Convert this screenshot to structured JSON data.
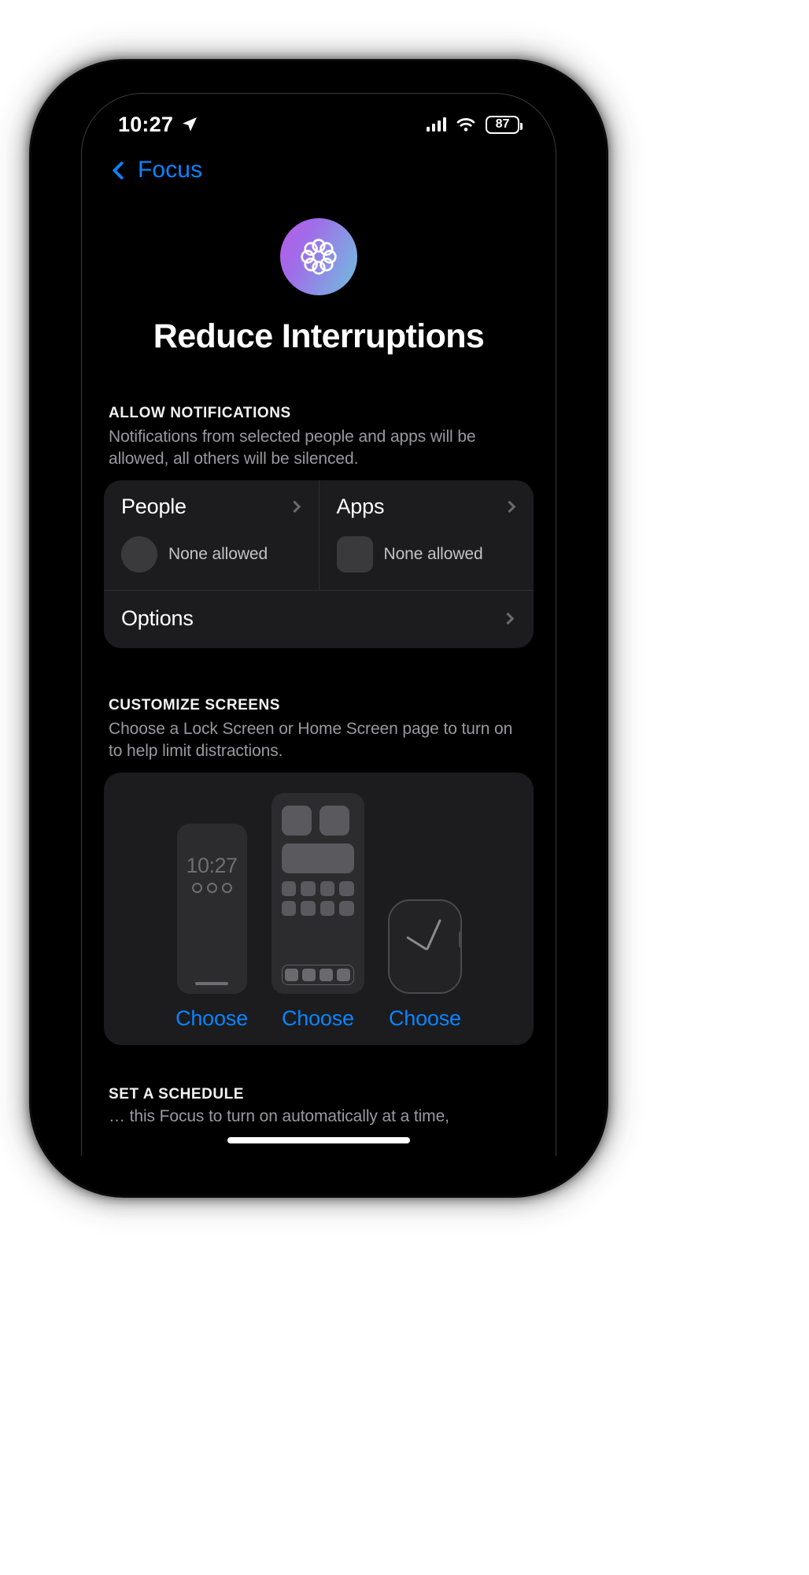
{
  "status_bar": {
    "time": "10:27",
    "location_icon": "location-arrow-icon",
    "cellular_icon": "cellular-bars-icon",
    "wifi_icon": "wifi-icon",
    "battery_percent": "87"
  },
  "nav": {
    "back_label": "Focus",
    "back_icon": "chevron-left-icon",
    "accent": "#0A84FF"
  },
  "hero": {
    "icon_name": "reduce-interruptions-focus-icon",
    "gradient_from": "#B75CE8",
    "gradient_to": "#6FC0DD",
    "title": "Reduce Interruptions"
  },
  "allow_notifications": {
    "header": "ALLOW NOTIFICATIONS",
    "description": "Notifications from selected people and apps will be allowed, all others will be silenced.",
    "people": {
      "title": "People",
      "chevron": "chevron-right-icon",
      "avatar": "person-avatar-placeholder",
      "status": "None allowed"
    },
    "apps": {
      "title": "Apps",
      "chevron": "chevron-right-icon",
      "avatar": "app-icon-placeholder",
      "status": "None allowed"
    },
    "options": {
      "label": "Options",
      "chevron": "chevron-right-icon"
    }
  },
  "customize_screens": {
    "header": "CUSTOMIZE SCREENS",
    "description": "Choose a Lock Screen or Home Screen page to turn on to help limit distractions.",
    "previews": [
      {
        "type": "lock-screen-preview",
        "time": "10:27",
        "choose_label": "Choose"
      },
      {
        "type": "home-screen-preview",
        "choose_label": "Choose"
      },
      {
        "type": "watch-face-preview",
        "choose_label": "Choose"
      }
    ]
  },
  "set_schedule": {
    "header": "SET A SCHEDULE",
    "description": "… this Focus to turn on automatically at a time,"
  }
}
